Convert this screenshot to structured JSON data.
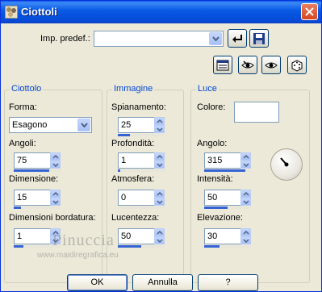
{
  "window": {
    "title": "Ciottoli"
  },
  "preset": {
    "label": "Imp. predef.:",
    "value": ""
  },
  "group_ciottolo": {
    "title": "Ciottolo",
    "forma_label": "Forma:",
    "forma_value": "Esagono",
    "angoli_label": "Angoli:",
    "angoli_value": "75",
    "angoli_level": 0.75,
    "dimensione_label": "Dimensione:",
    "dimensione_value": "15",
    "dimensione_level": 0.15,
    "bordatura_label": "Dimensioni bordatura:",
    "bordatura_value": "1",
    "bordatura_level": 0.2
  },
  "group_immagine": {
    "title": "Immagine",
    "spianamento_label": "Spianamento:",
    "spianamento_value": "25",
    "spianamento_level": 0.25,
    "profondita_label": "Profondità:",
    "profondita_value": "1",
    "profondita_level": 0.05,
    "atmosfera_label": "Atmosfera:",
    "atmosfera_value": "0",
    "atmosfera_level": 0.0,
    "lucentezza_label": "Lucentezza:",
    "lucentezza_value": "50",
    "lucentezza_level": 0.5
  },
  "group_luce": {
    "title": "Luce",
    "colore_label": "Colore:",
    "colore_value": "#ffffff",
    "angolo_label": "Angolo:",
    "angolo_value": "315",
    "angolo_level": 0.875,
    "intensita_label": "Intensità:",
    "intensita_value": "50",
    "intensita_level": 0.5,
    "elevazione_label": "Elevazione:",
    "elevazione_value": "30",
    "elevazione_level": 0.33
  },
  "watermark": {
    "line1": "Pinuccia",
    "line2": "www.maidiregrafica.eu"
  },
  "buttons": {
    "ok": "OK",
    "cancel": "Annulla",
    "help": "?"
  },
  "colors": {
    "title_bar": "#0b5ce6",
    "group_title": "#0046d5",
    "slider_fill": "#3563d6"
  }
}
